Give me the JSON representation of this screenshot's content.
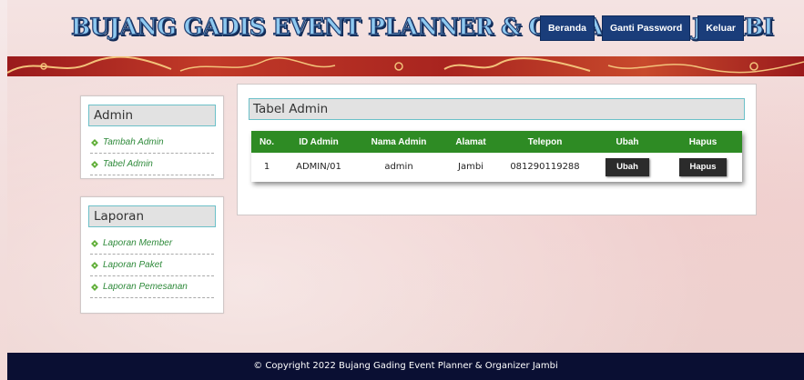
{
  "header": {
    "site_title": "BUJANG GADIS EVENT PLANNER & ORGANIZER JAMBI",
    "nav": [
      {
        "label": "Beranda"
      },
      {
        "label": "Ganti Password"
      },
      {
        "label": "Keluar"
      }
    ]
  },
  "sidebar": {
    "admin": {
      "title": "Admin",
      "items": [
        {
          "label": "Tambah Admin"
        },
        {
          "label": "Tabel Admin"
        }
      ]
    },
    "laporan": {
      "title": "Laporan",
      "items": [
        {
          "label": "Laporan Member"
        },
        {
          "label": "Laporan Paket"
        },
        {
          "label": "Laporan Pemesanan"
        }
      ]
    }
  },
  "main": {
    "title": "Tabel Admin",
    "columns": [
      "No.",
      "ID Admin",
      "Nama Admin",
      "Alamat",
      "Telepon",
      "Ubah",
      "Hapus"
    ],
    "rows": [
      {
        "no": "1",
        "id_admin": "ADMIN/01",
        "nama_admin": "admin",
        "alamat": "Jambi",
        "telepon": "081290119288",
        "ubah": "Ubah",
        "hapus": "Hapus"
      }
    ]
  },
  "footer": {
    "copyright": "© Copyright 2022 Bujang Gading Event Planner & Organizer Jambi"
  },
  "colors": {
    "nav_button": "#1a3d7a",
    "table_header": "#2e8b24",
    "sidebar_link": "#2f8a3b",
    "footer_bg": "#0a0f33",
    "band": "#a8241f"
  }
}
